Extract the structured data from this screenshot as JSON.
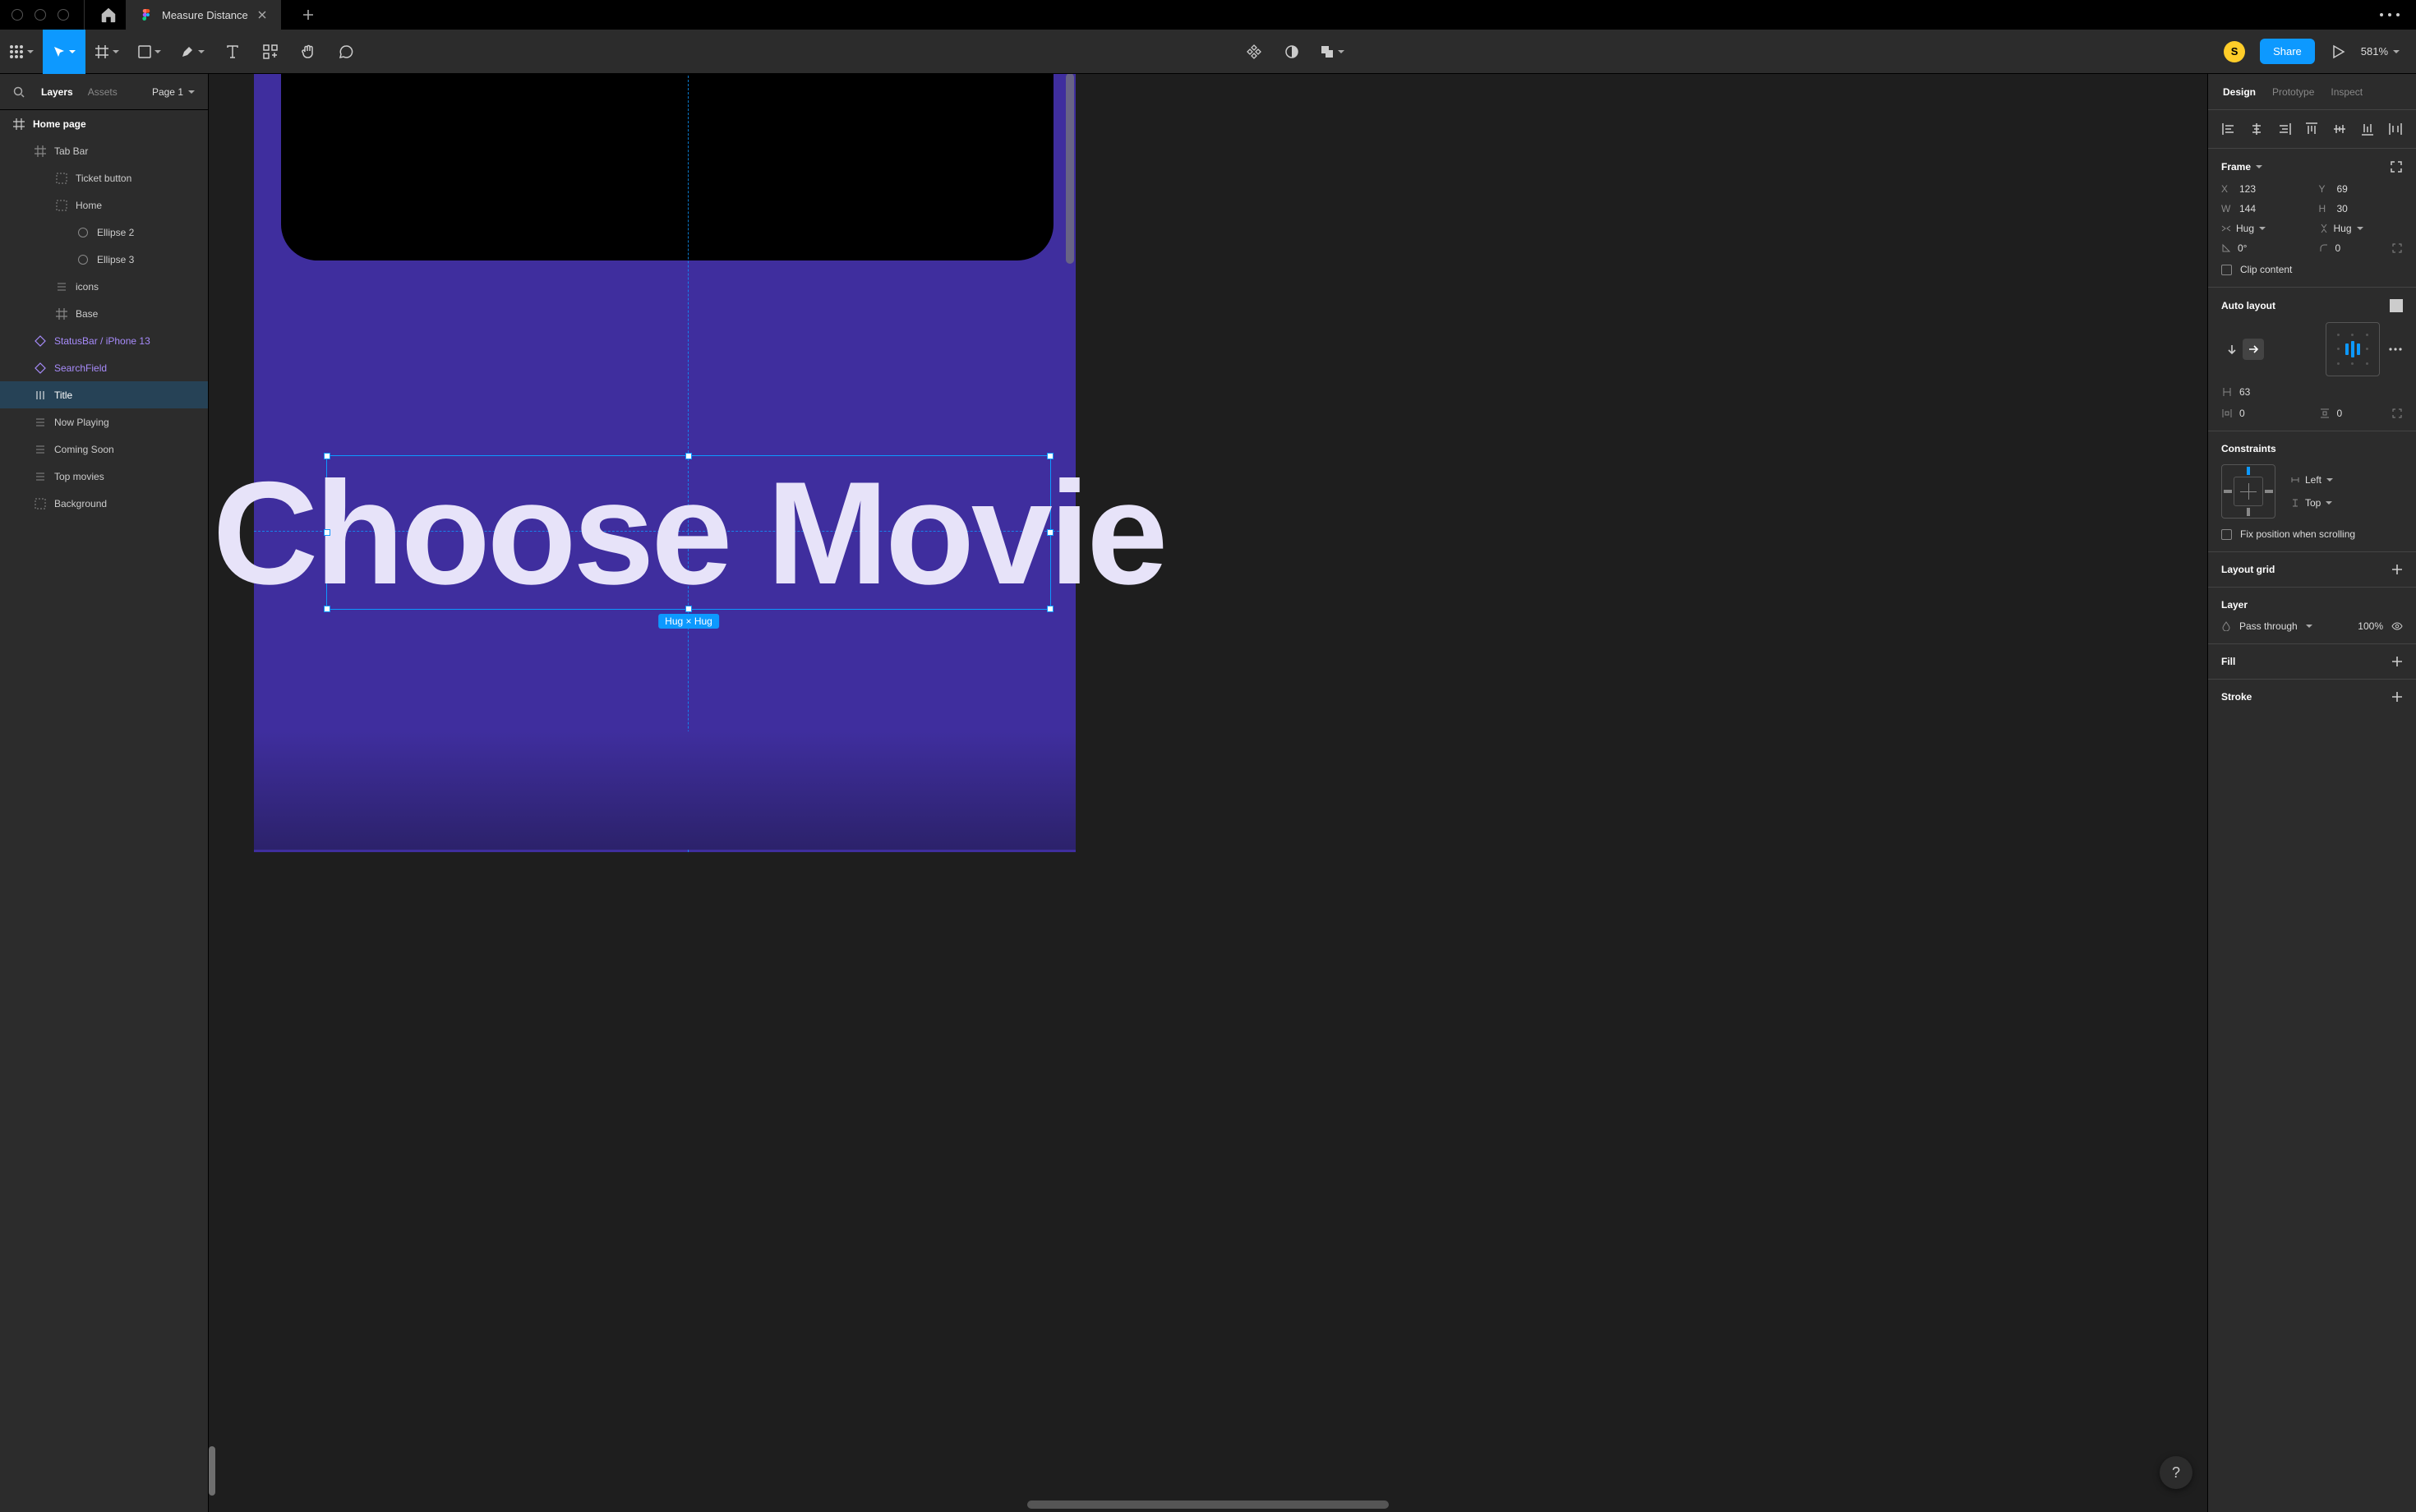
{
  "tab": {
    "name": "Measure Distance"
  },
  "toolbar": {
    "avatar_initial": "S",
    "share_label": "Share",
    "zoom": "581%"
  },
  "left_panel": {
    "tabs": {
      "layers": "Layers",
      "assets": "Assets"
    },
    "page_label": "Page 1",
    "tree": {
      "home_page": "Home page",
      "tab_bar": "Tab Bar",
      "ticket_button": "Ticket button",
      "home": "Home",
      "ellipse2": "Ellipse 2",
      "ellipse3": "Ellipse 3",
      "icons": "icons",
      "base": "Base",
      "statusbar": "StatusBar / iPhone 13",
      "searchfield": "SearchField",
      "title": "Title",
      "now_playing": "Now Playing",
      "coming_soon": "Coming Soon",
      "top_movies": "Top movies",
      "background": "Background"
    }
  },
  "canvas": {
    "title_text": "Choose Movie",
    "size_badge": "Hug × Hug"
  },
  "right_panel": {
    "tabs": {
      "design": "Design",
      "prototype": "Prototype",
      "inspect": "Inspect"
    },
    "frame": {
      "label": "Frame",
      "x_label": "X",
      "x": "123",
      "y_label": "Y",
      "y": "69",
      "w_label": "W",
      "w": "144",
      "h_label": "H",
      "h": "30",
      "hug_w": "Hug",
      "hug_h": "Hug",
      "rotation": "0°",
      "radius": "0",
      "clip": "Clip content"
    },
    "auto_layout": {
      "label": "Auto layout",
      "gap": "63",
      "pad_h": "0",
      "pad_v": "0"
    },
    "constraints": {
      "label": "Constraints",
      "h": "Left",
      "v": "Top",
      "fix": "Fix position when scrolling"
    },
    "layout_grid": {
      "label": "Layout grid"
    },
    "layer": {
      "label": "Layer",
      "blend": "Pass through",
      "opacity": "100%"
    },
    "fill": {
      "label": "Fill"
    },
    "stroke": {
      "label": "Stroke"
    }
  },
  "help": "?"
}
